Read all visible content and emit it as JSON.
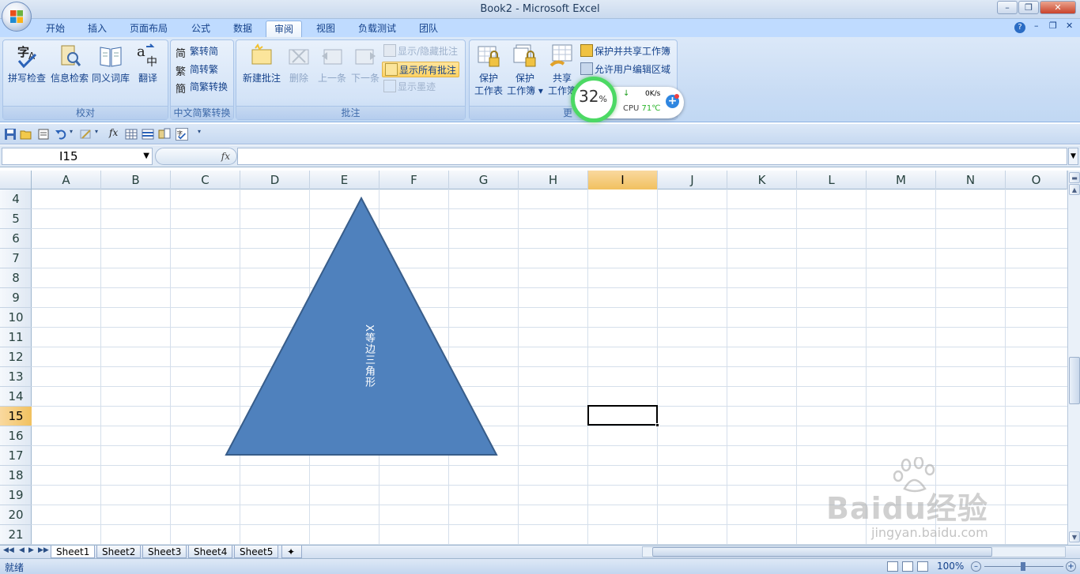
{
  "window": {
    "title": "Book2 - Microsoft Excel"
  },
  "tabs": [
    "开始",
    "插入",
    "页面布局",
    "公式",
    "数据",
    "审阅",
    "视图",
    "负载测试",
    "团队"
  ],
  "active_tab": "审阅",
  "ribbon": {
    "proofing": {
      "label": "校对",
      "spell": "拼写检查",
      "research": "信息检索",
      "thesaurus": "同义词库",
      "translate": "翻译"
    },
    "chinese": {
      "label": "中文简繁转换",
      "to_simplified": "繁转简",
      "to_traditional": "简转繁",
      "convert": "简繁转换"
    },
    "comments": {
      "label": "批注",
      "new": "新建批注",
      "delete": "删除",
      "prev": "上一条",
      "next": "下一条",
      "show_hide": "显示/隐藏批注",
      "show_all": "显示所有批注",
      "show_ink": "显示墨迹"
    },
    "changes": {
      "label": "更",
      "protect_sheet_1": "保护",
      "protect_sheet_2": "工作表",
      "protect_book_1": "保护",
      "protect_book_2": "工作簿",
      "share_1": "共享",
      "share_2": "工作簿",
      "protect_share": "保护并共享工作簿",
      "allow_edit": "允许用户编辑区域"
    }
  },
  "formula_bar": {
    "name_box": "I15",
    "fx": "fx",
    "value": ""
  },
  "columns": [
    "A",
    "B",
    "C",
    "D",
    "E",
    "F",
    "G",
    "H",
    "I",
    "J",
    "K",
    "L",
    "M",
    "N",
    "O"
  ],
  "selected_column": "I",
  "rows": [
    "4",
    "5",
    "6",
    "7",
    "8",
    "9",
    "10",
    "11",
    "12",
    "13",
    "14",
    "15",
    "16",
    "17",
    "18",
    "19",
    "20",
    "21"
  ],
  "selected_row": "15",
  "shape": {
    "text": "X等边三角形",
    "fill": "#4f81bd",
    "stroke": "#385d8a"
  },
  "sheets": [
    "Sheet1",
    "Sheet2",
    "Sheet3",
    "Sheet4",
    "Sheet5"
  ],
  "active_sheet": "Sheet1",
  "status": {
    "text": "就绪",
    "zoom": "100%"
  },
  "widget": {
    "percent": "32",
    "percent_sign": "%",
    "net_speed": "0K/s",
    "cpu_label": "CPU",
    "cpu_temp": "71℃"
  },
  "watermark": {
    "brand": "Baidu经验",
    "url": "jingyan.baidu.com"
  },
  "colors": {
    "accent": "#4f81bd",
    "ribbon": "#c7dbf4",
    "selection": "#f1c15f"
  }
}
